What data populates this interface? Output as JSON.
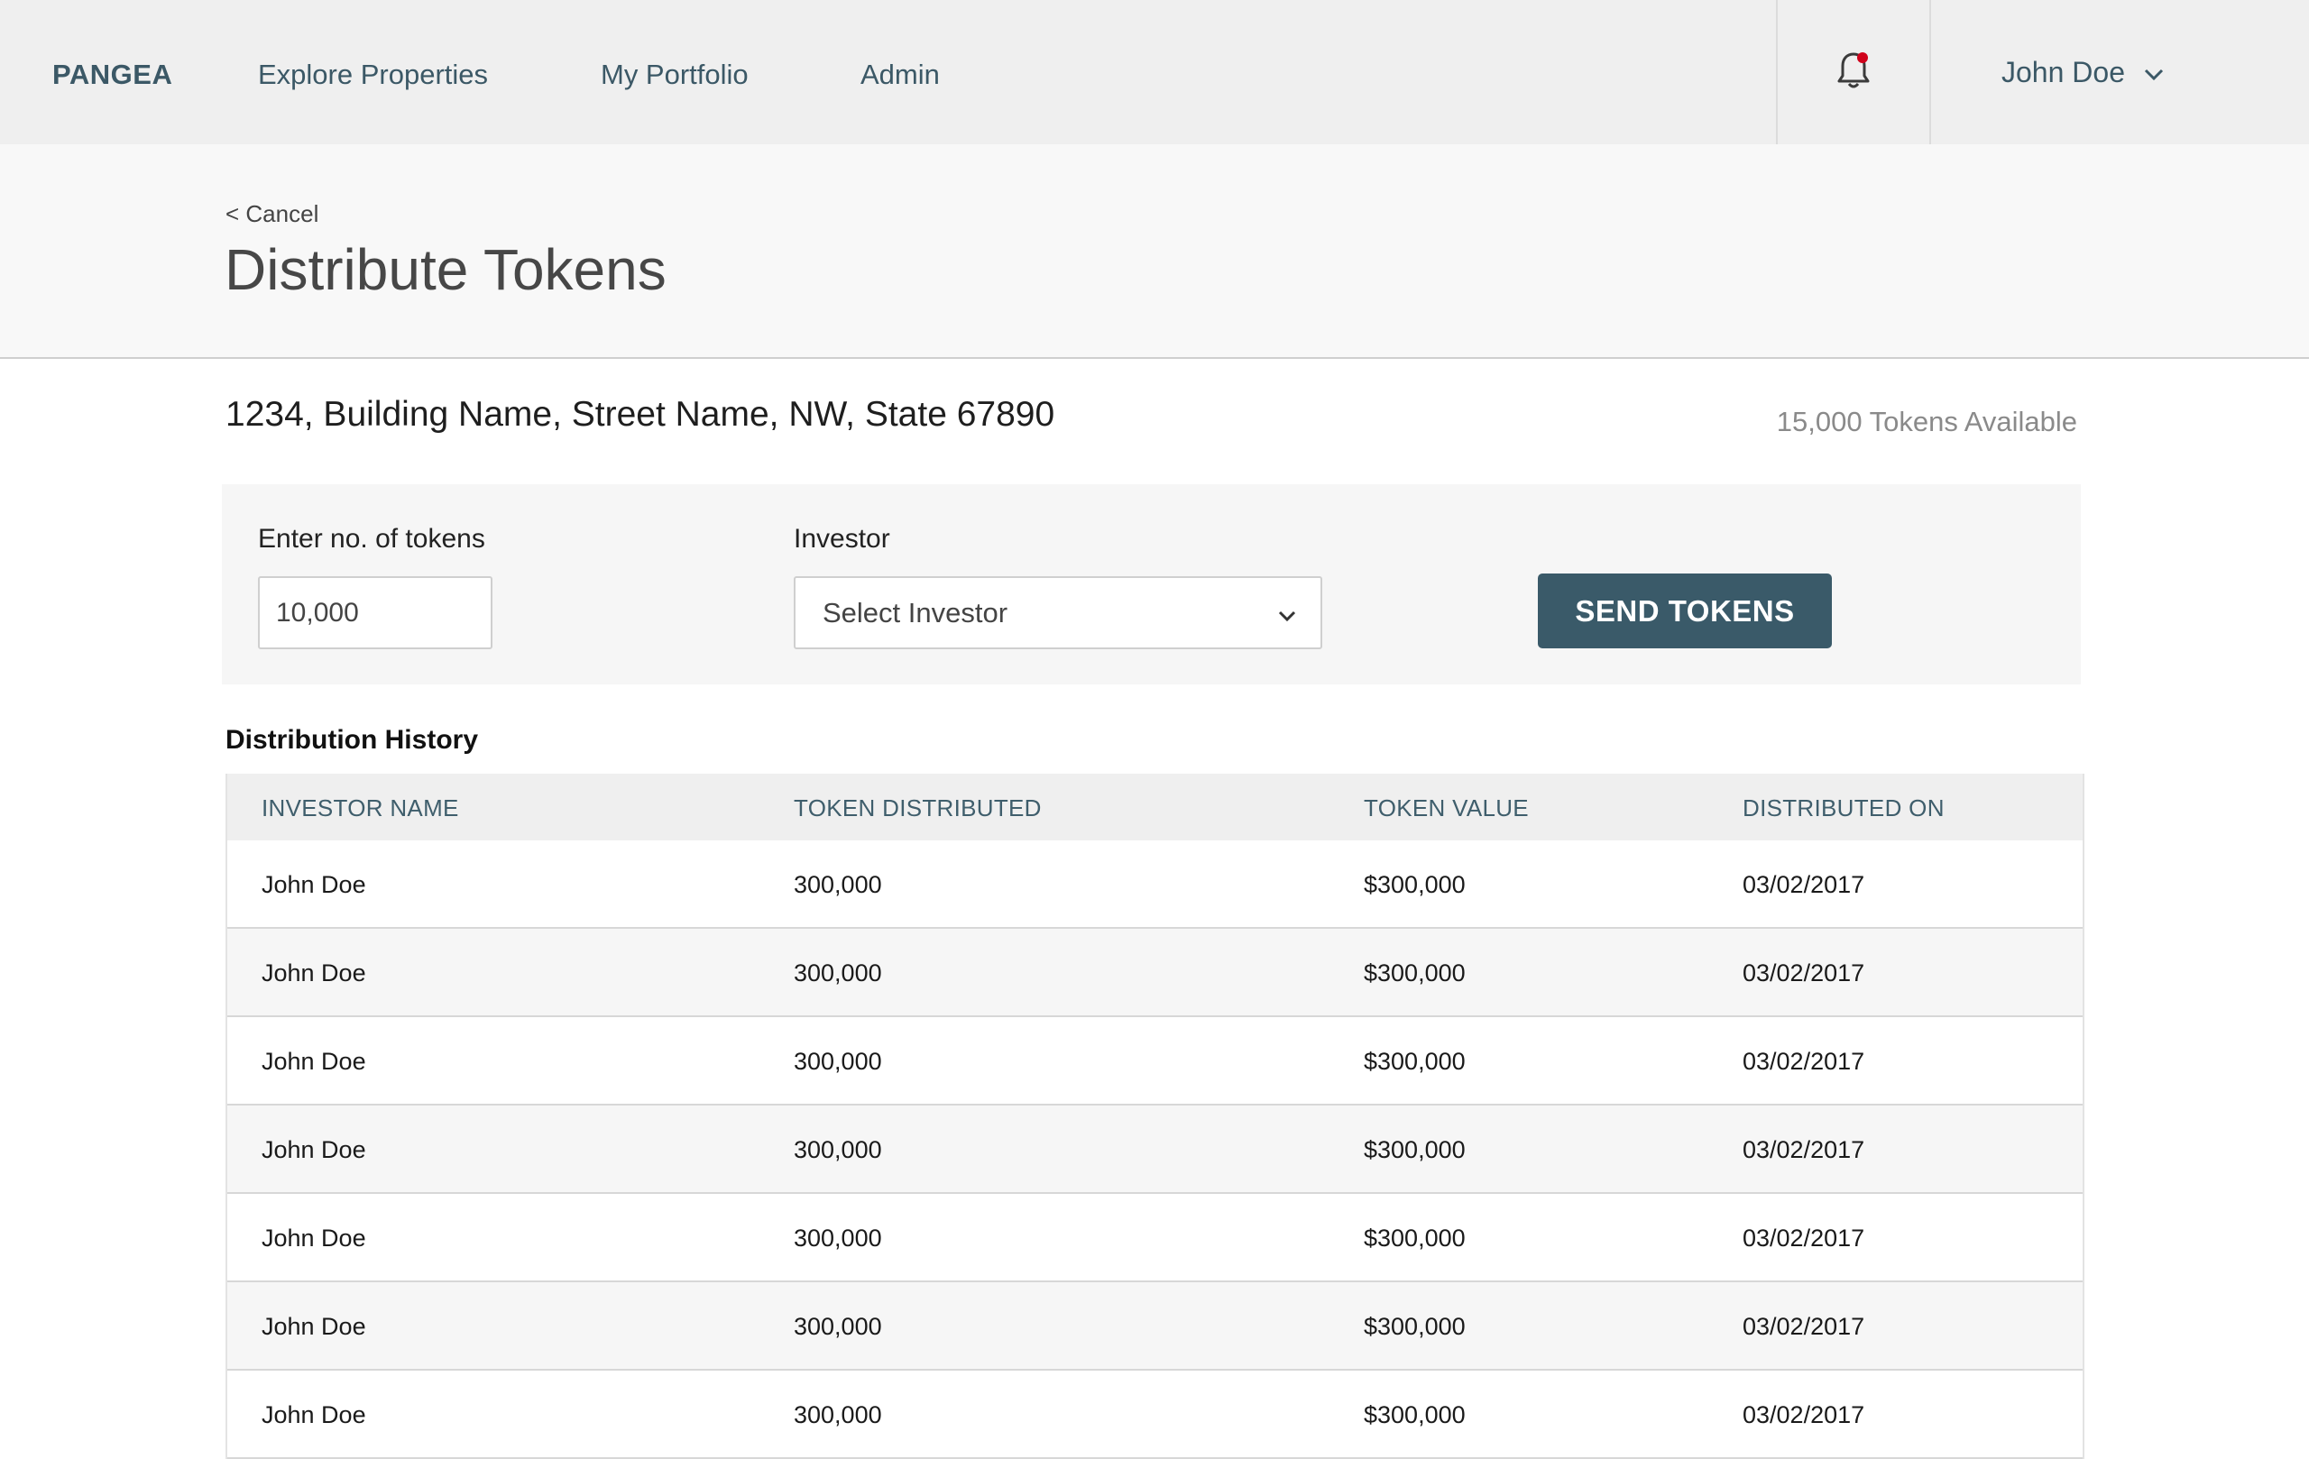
{
  "nav": {
    "brand": "PANGEA",
    "links": [
      "Explore Properties",
      "My Portfolio",
      "Admin"
    ],
    "user_name": "John Doe"
  },
  "header": {
    "cancel_label": "< Cancel",
    "title": "Distribute Tokens"
  },
  "property": {
    "address": "1234, Building Name, Street Name, NW, State 67890",
    "tokens_available": "15,000 Tokens Available"
  },
  "form": {
    "tokens_label": "Enter no. of tokens",
    "tokens_value": "10,000",
    "investor_label": "Investor",
    "investor_placeholder": "Select Investor",
    "send_label": "SEND TOKENS"
  },
  "history": {
    "title": "Distribution History",
    "columns": [
      "INVESTOR NAME",
      "TOKEN DISTRIBUTED",
      "TOKEN VALUE",
      "DISTRIBUTED ON"
    ],
    "rows": [
      [
        "John Doe",
        "300,000",
        "$300,000",
        "03/02/2017"
      ],
      [
        "John Doe",
        "300,000",
        "$300,000",
        "03/02/2017"
      ],
      [
        "John Doe",
        "300,000",
        "$300,000",
        "03/02/2017"
      ],
      [
        "John Doe",
        "300,000",
        "$300,000",
        "03/02/2017"
      ],
      [
        "John Doe",
        "300,000",
        "$300,000",
        "03/02/2017"
      ],
      [
        "John Doe",
        "300,000",
        "$300,000",
        "03/02/2017"
      ],
      [
        "John Doe",
        "300,000",
        "$300,000",
        "03/02/2017"
      ]
    ]
  },
  "colors": {
    "accent": "#3a5a69",
    "notification_dot": "#d0021b",
    "nav_bg": "#efefef"
  },
  "icons": {
    "bell": "bell-icon",
    "user_menu": "chevron-down-icon",
    "select": "chevron-down-icon"
  }
}
